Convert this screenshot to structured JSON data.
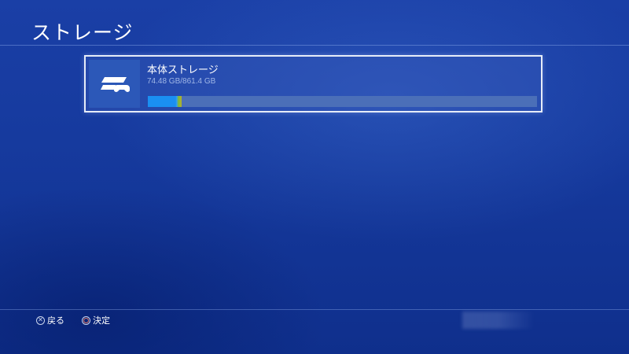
{
  "header": {
    "title": "ストレージ"
  },
  "storage": {
    "name": "本体ストレージ",
    "usage_text": "74.48 GB/861.4 GB",
    "used_fraction": 0.0865,
    "icon": "ps4-console-icon",
    "bar_color": "#1a8ff2"
  },
  "footer": {
    "back_label": "戻る",
    "back_icon": "cross-button-icon",
    "confirm_label": "決定",
    "confirm_icon": "circle-button-icon"
  }
}
